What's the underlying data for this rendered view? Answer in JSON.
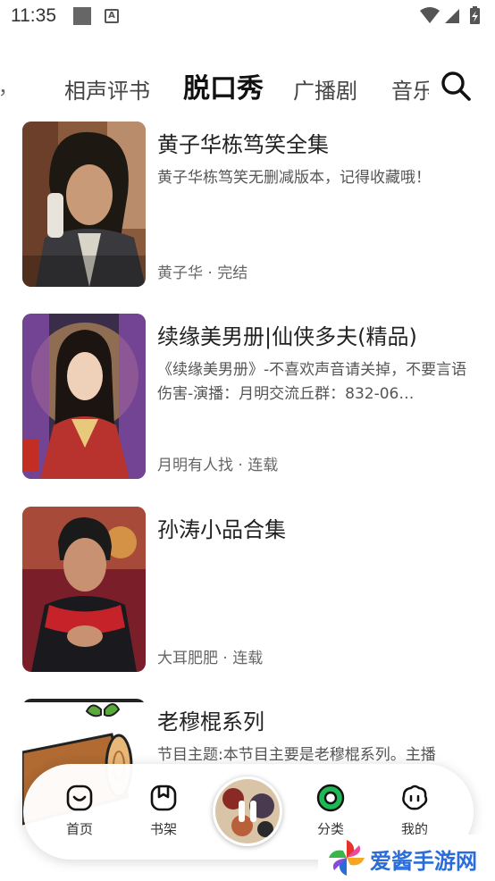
{
  "status_bar": {
    "time": "11:35"
  },
  "tabs": [
    {
      "label": "相声评书",
      "active": false
    },
    {
      "label": "脱口秀",
      "active": true
    },
    {
      "label": "广播剧",
      "active": false
    },
    {
      "label": "音乐",
      "active": false
    }
  ],
  "list": [
    {
      "title": "黄子华栋笃笑全集",
      "desc": "黄子华栋笃笑无删减版本，记得收藏哦！",
      "meta": "黄子华 · 完结"
    },
    {
      "title": "续缘美男册|仙侠多夫(精品)",
      "desc": "《续缘美男册》-不喜欢声音请关掉，不要言语伤害-演播：月明交流丘群：832-06…",
      "meta": "月明有人找 · 连载"
    },
    {
      "title": "孙涛小品合集",
      "desc": "",
      "meta": "大耳肥肥 · 连载"
    },
    {
      "title": "老穆棍系列",
      "desc": "节目主题:本节目主要是老穆棍系列。主播",
      "meta": ""
    }
  ],
  "bottom_nav": [
    {
      "label": "首页",
      "icon": "home-icon"
    },
    {
      "label": "书架",
      "icon": "bookshelf-icon"
    },
    {
      "label": "分类",
      "icon": "category-icon"
    },
    {
      "label": "我的",
      "icon": "profile-icon"
    }
  ],
  "watermark": {
    "text": "爱酱手游网"
  },
  "colors": {
    "accent_green": "#1db954",
    "brand_blue": "#2a6dd9"
  }
}
